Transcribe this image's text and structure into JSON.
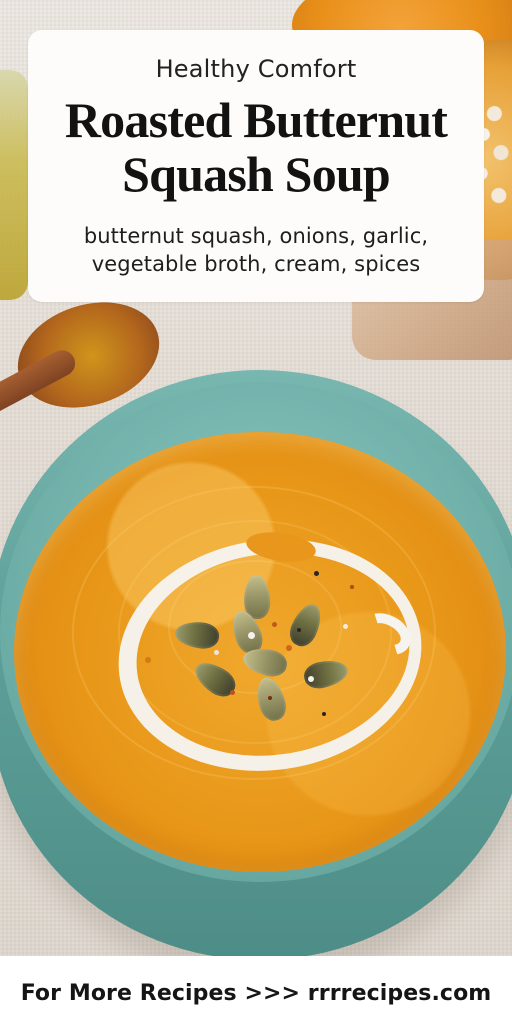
{
  "header": {
    "eyebrow": "Healthy Comfort",
    "title": "Roasted Butternut Squash Soup",
    "ingredients": "butternut squash, onions, garlic, vegetable broth, cream, spices"
  },
  "footer": {
    "cta": "For More Recipes >>> rrrrecipes.com"
  },
  "colors": {
    "card": "#fdfcfa",
    "soup": "#e89718",
    "bowl": "#5c9f98",
    "cream": "#f6f4ee",
    "text": "#121212"
  }
}
